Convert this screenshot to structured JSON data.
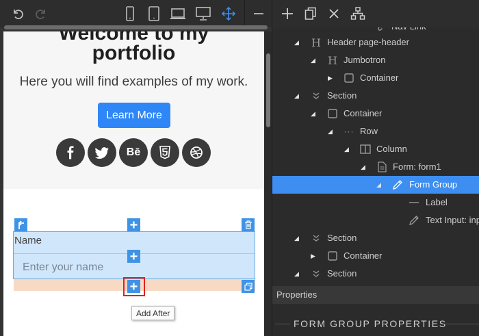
{
  "toolbar": {
    "icons": [
      "undo-icon",
      "redo-icon",
      "phone-icon",
      "tablet-icon",
      "laptop-icon",
      "desktop-icon",
      "move-icon",
      "minimize-icon"
    ]
  },
  "preview": {
    "title_line1": "Welcome to my",
    "title_line2": "portfolio",
    "lead": "Here you will find examples of my work.",
    "learn_more": "Learn More",
    "social": [
      "f",
      "t",
      "Bē",
      "5",
      "⊛"
    ],
    "form_group": {
      "label": "Name",
      "input_placeholder": "Enter your name"
    },
    "add_after_tooltip": "Add After",
    "colors": {
      "accent": "#2f86f6",
      "selection": "#cfe6fb",
      "margin": "#f8d9c4",
      "highlight": "#e0211b"
    }
  },
  "right_toolbar": {
    "icons": [
      "plus-icon",
      "copy-icon",
      "close-icon",
      "sitemap-icon"
    ]
  },
  "tree": [
    {
      "label": "Nav Link",
      "icon": "link-icon"
    },
    {
      "label": "Header page-header",
      "icon": "heading-icon",
      "toggle": "open"
    },
    {
      "label": "Jumbotron",
      "icon": "heading-icon",
      "toggle": "open"
    },
    {
      "label": "Container",
      "icon": "square-icon",
      "toggle": "closed"
    },
    {
      "label": "Section",
      "icon": "chevron-icon",
      "toggle": "open"
    },
    {
      "label": "Container",
      "icon": "square-icon",
      "toggle": "open"
    },
    {
      "label": "Row",
      "icon": "dots-icon",
      "toggle": "open"
    },
    {
      "label": "Column",
      "icon": "column-icon",
      "toggle": "open"
    },
    {
      "label": "Form: form1",
      "icon": "file-icon",
      "toggle": "open"
    },
    {
      "label": "Form Group",
      "icon": "pencil-icon",
      "toggle": "open",
      "selected": true
    },
    {
      "label": "Label",
      "icon": "dash-icon"
    },
    {
      "label": "Text Input: inp",
      "icon": "pencil-icon"
    },
    {
      "label": "Section",
      "icon": "chevron-icon",
      "toggle": "open"
    },
    {
      "label": "Container",
      "icon": "square-icon",
      "toggle": "closed"
    },
    {
      "label": "Section",
      "icon": "chevron-icon",
      "toggle": "open"
    }
  ],
  "properties": {
    "header": "Properties",
    "section_title": "FORM GROUP PROPERTIES"
  }
}
